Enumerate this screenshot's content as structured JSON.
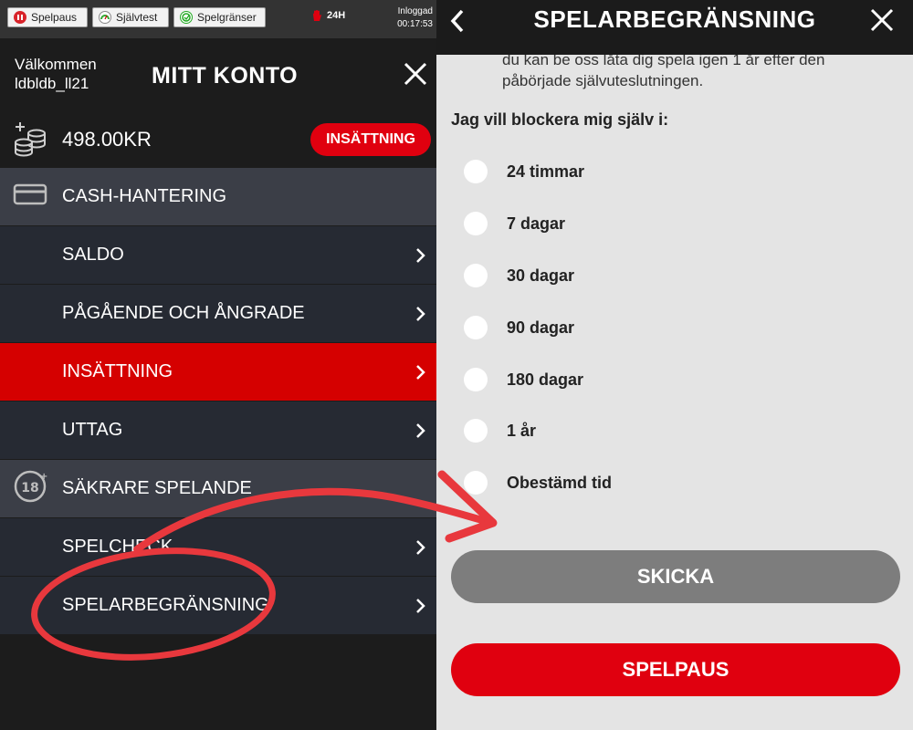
{
  "top_bar": {
    "chips": [
      {
        "label": "Spelpaus",
        "icon": "pause-icon"
      },
      {
        "label": "Självtest",
        "icon": "gauge-icon"
      },
      {
        "label": "Spelgränser",
        "icon": "limits-icon"
      }
    ],
    "timer_label": "24H",
    "login_status": "Inloggad",
    "login_time": "00:17:53"
  },
  "account": {
    "welcome_line1": "Välkommen",
    "username": "ldbldb_ll21",
    "title": "MITT KONTO",
    "balance": "498.00KR",
    "deposit_button": "INSÄTTNING"
  },
  "menu": [
    {
      "label": "CASH-HANTERING",
      "type": "section",
      "icon": "card-icon"
    },
    {
      "label": "SALDO",
      "type": "item"
    },
    {
      "label": "PÅGÅENDE OCH ÅNGRADE",
      "type": "item"
    },
    {
      "label": "INSÄTTNING",
      "type": "active"
    },
    {
      "label": "UTTAG",
      "type": "item"
    },
    {
      "label": "SÄKRARE SPELANDE",
      "type": "section",
      "icon": "age-18-icon"
    },
    {
      "label": "SPELCHECK",
      "type": "item"
    },
    {
      "label": "SPELARBEGRÄNSNING",
      "type": "item"
    }
  ],
  "panel": {
    "title": "SPELARBEGRÄNSNING",
    "intro_text": "du kan be oss låta dig spela igen 1 år efter den påbörjade självuteslutningen.",
    "question": "Jag vill blockera mig själv i:",
    "options": [
      "24 timmar",
      "7 dagar",
      "30 dagar",
      "90 dagar",
      "180 dagar",
      "1 år",
      "Obestämd tid"
    ],
    "submit_button": "SKICKA",
    "pause_button": "SPELPAUS"
  },
  "colors": {
    "brand_red": "#e0000f",
    "active_row": "#d50000",
    "section_row": "#3b3e47",
    "item_row": "#262a33",
    "annotation_red": "#e8383d"
  }
}
